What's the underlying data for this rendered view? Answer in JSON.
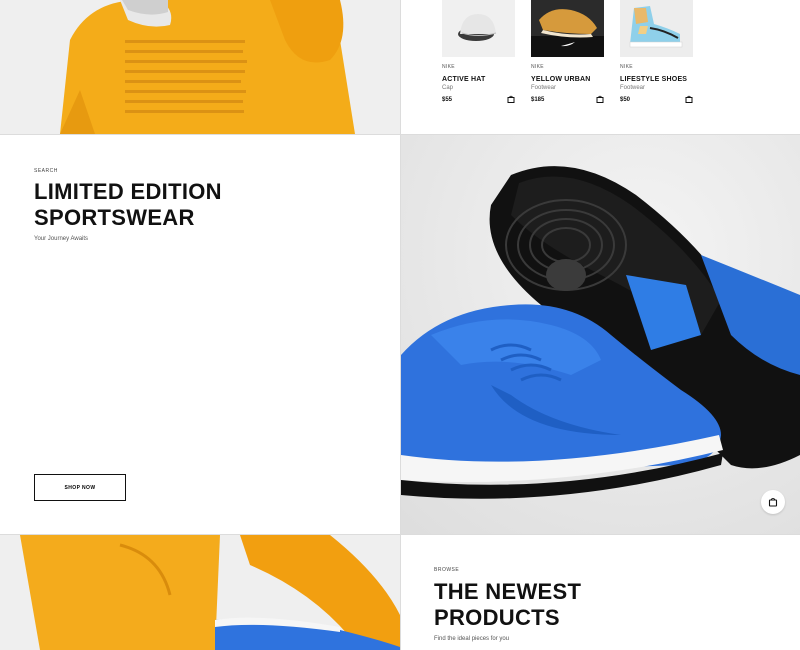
{
  "products": [
    {
      "brand": "NIKE",
      "name": "ACTIVE HAT",
      "category": "Cap",
      "price": "$55",
      "image": "cap-image"
    },
    {
      "brand": "NIKE",
      "name": "YELLOW URBAN",
      "category": "Footwear",
      "price": "$185",
      "image": "sneaker-box-image"
    },
    {
      "brand": "NIKE",
      "name": "LIFESTYLE SHOES",
      "category": "Footwear",
      "price": "$50",
      "image": "high-top-sneaker-image"
    }
  ],
  "hero": {
    "eyebrow": "SEARCH",
    "headline_line1": "LIMITED EDITION",
    "headline_line2": "SPORTSWEAR",
    "tagline": "Your Journey Awaits",
    "button_label": "SHOP NOW"
  },
  "newest": {
    "eyebrow": "BROWSE",
    "headline_line1": "THE NEWEST",
    "headline_line2": "PRODUCTS",
    "tagline": "Find the ideal pieces for you"
  },
  "icons": {
    "cart": "shopping-bag-icon"
  },
  "colors": {
    "accent_blue": "#1f6fe0",
    "mustard": "#f2a81e",
    "text": "#111111"
  }
}
